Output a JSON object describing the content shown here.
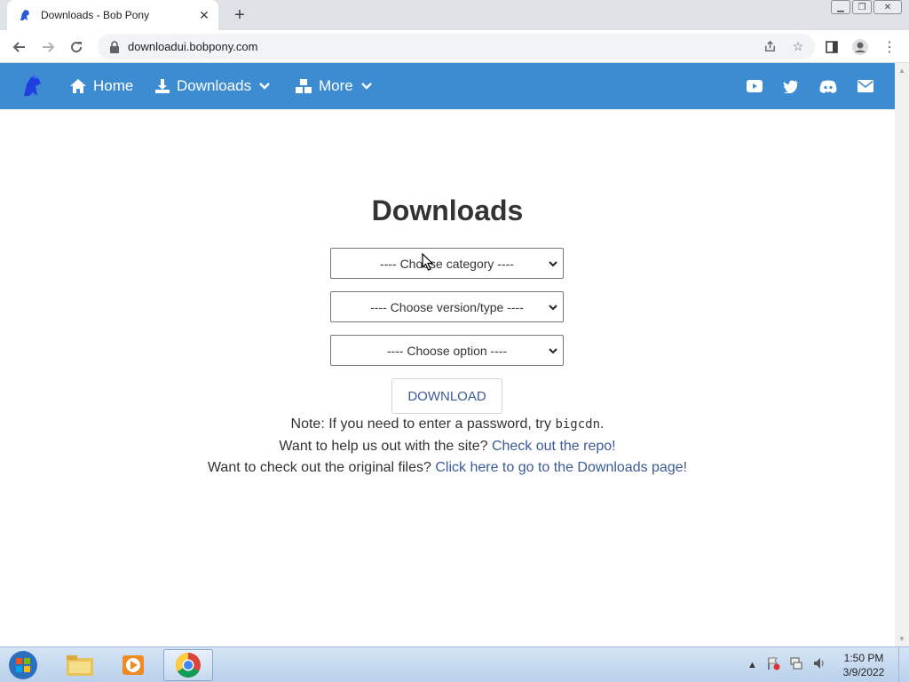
{
  "browser": {
    "tab_title": "Downloads - Bob Pony",
    "url": "downloadui.bobpony.com"
  },
  "navbar": {
    "home_label": "Home",
    "downloads_label": "Downloads",
    "more_label": "More"
  },
  "main": {
    "title": "Downloads",
    "select_category": "---- Choose category ----",
    "select_version": "---- Choose version/type ----",
    "select_option": "---- Choose option ----",
    "download_button": "DOWNLOAD",
    "note_prefix": "Note: If you need to enter a password, try ",
    "note_password": "bigcdn",
    "note_suffix": ".",
    "help_prefix": "Want to help us out with the site? ",
    "help_link": "Check out the repo!",
    "files_prefix": "Want to check out the original files? ",
    "files_link": "Click here to go to the Downloads page!"
  },
  "taskbar": {
    "time": "1:50 PM",
    "date": "3/9/2022"
  },
  "colors": {
    "navbar": "#3d8bd0",
    "link": "#3c5a99"
  }
}
